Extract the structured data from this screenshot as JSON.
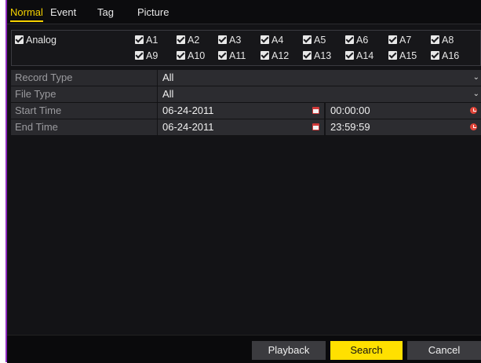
{
  "tabs": [
    "Normal",
    "Event",
    "Tag",
    "Picture"
  ],
  "channels": {
    "group_label": "Analog",
    "row1": [
      "A1",
      "A2",
      "A3",
      "A4",
      "A5",
      "A6",
      "A7",
      "A8"
    ],
    "row2": [
      "A9",
      "A10",
      "A11",
      "A12",
      "A13",
      "A14",
      "A15",
      "A16"
    ]
  },
  "form": {
    "record_type_label": "Record Type",
    "record_type_value": "All",
    "file_type_label": "File Type",
    "file_type_value": "All",
    "start_time_label": "Start Time",
    "start_date": "06-24-2011",
    "start_clock": "00:00:00",
    "end_time_label": "End Time",
    "end_date": "06-24-2011",
    "end_clock": "23:59:59"
  },
  "buttons": {
    "playback": "Playback",
    "search": "Search",
    "cancel": "Cancel"
  },
  "colors": {
    "accent": "#f5d100",
    "search_button": "#ffe000",
    "border_accent": "#8f2bbf"
  }
}
